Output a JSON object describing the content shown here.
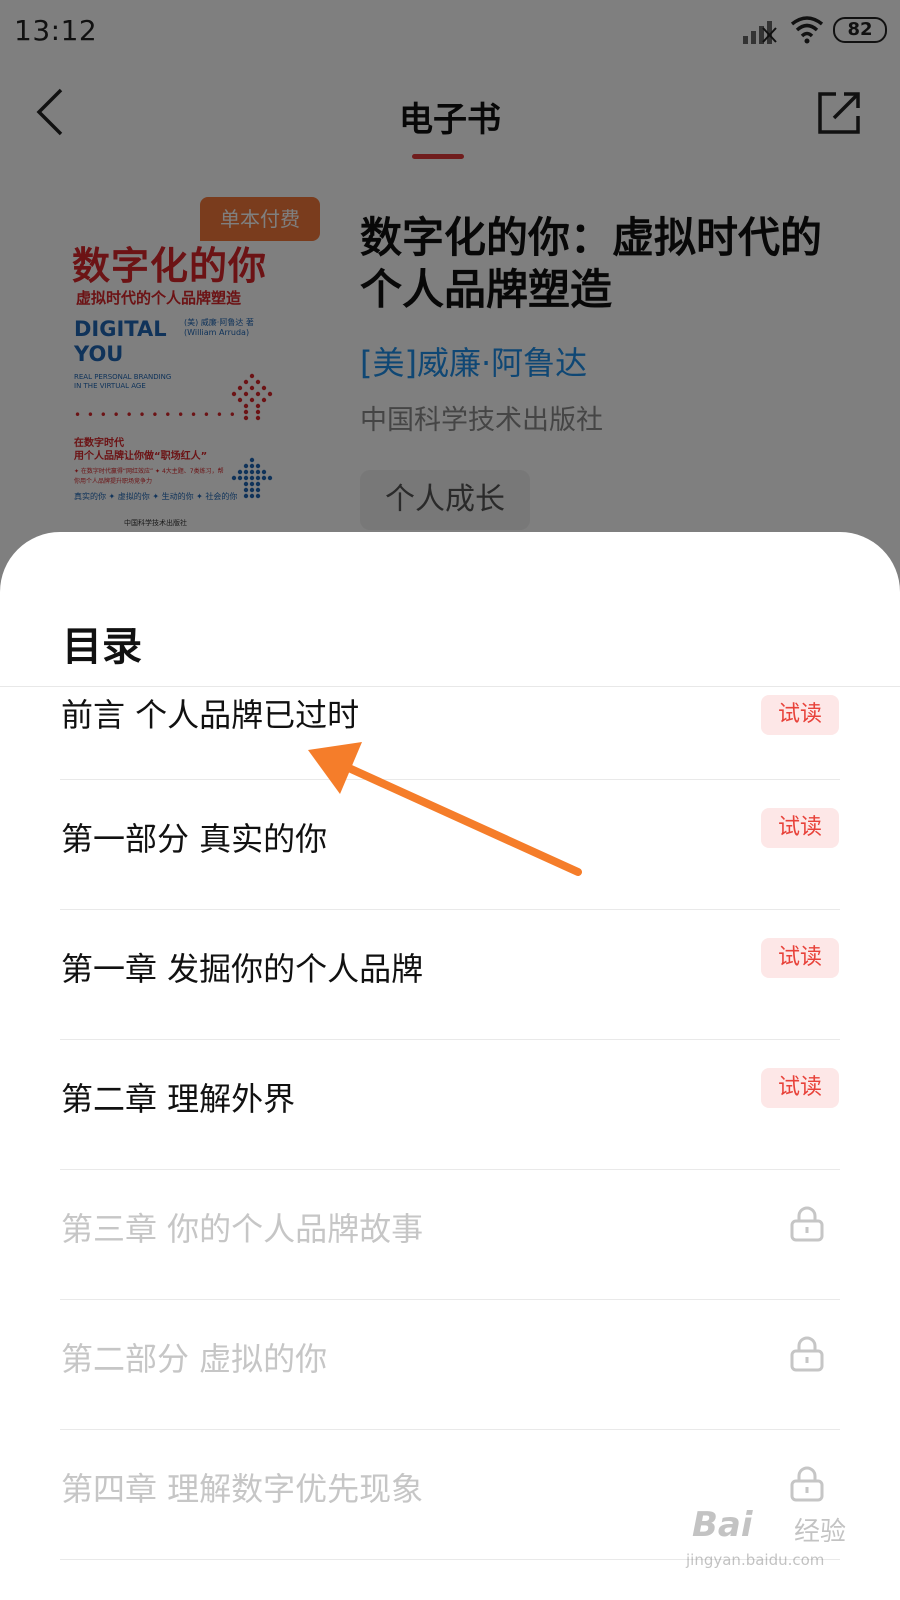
{
  "status_bar": {
    "time": "13:12",
    "battery": "82"
  },
  "header": {
    "title": "电子书"
  },
  "book": {
    "badge": "单本付费",
    "title_line1": "数字化的你：虚拟时代的",
    "title_line2": "个人品牌塑造",
    "author": "[美]威廉·阿鲁达",
    "publisher": "中国科学技术出版社",
    "tag": "个人成长",
    "cover": {
      "cn_title": "数字化的你",
      "cn_subtitle": "虚拟时代的个人品牌塑造",
      "en_title_1": "DIGITAL",
      "en_title_2": "YOU",
      "author_small": "(美) 威廉·阿鲁达 著",
      "author_en": "(William Arruda)",
      "en_tagline_1": "REAL PERSONAL BRANDING",
      "en_tagline_2": "IN THE VIRTUAL AGE",
      "slogan_1": "在数字时代",
      "slogan_2": "用个人品牌让你做“职场红人”",
      "bullets": "✦ 在数字时代赢得“网红效应” ✦ 4大主题、7类练习，帮你用个人品牌提升职场竞争力",
      "cover_tags": "真实的你 ✦ 虚拟的你 ✦ 生动的你 ✦ 社会的你",
      "publisher_small": "中国科学技术出版社"
    }
  },
  "toc": {
    "title": "目录",
    "trial_label": "试读",
    "items": [
      {
        "label": "前言  个人品牌已过时",
        "locked": false
      },
      {
        "label": "第一部分  真实的你",
        "locked": false
      },
      {
        "label": "第一章  发掘你的个人品牌",
        "locked": false
      },
      {
        "label": "第二章  理解外界",
        "locked": false
      },
      {
        "label": "第三章  你的个人品牌故事",
        "locked": true
      },
      {
        "label": "第二部分  虚拟的你",
        "locked": true
      },
      {
        "label": "第四章  理解数字优先现象",
        "locked": true
      }
    ]
  },
  "watermark": {
    "logo": "Bai",
    "cn": "经验",
    "url": "jingyan.baidu.com"
  },
  "colors": {
    "accent_red": "#e03a3a",
    "author_blue": "#1f8ee8",
    "badge_orange": "#f5793b",
    "annotation_arrow": "#f57d2a"
  }
}
